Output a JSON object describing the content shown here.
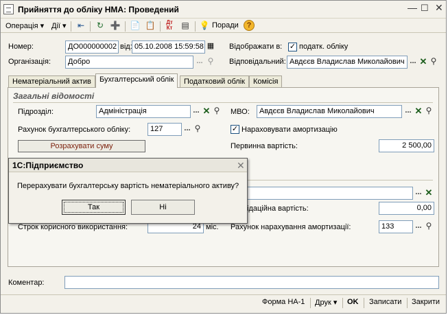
{
  "window": {
    "title": "Прийняття до обліку НМА: Проведений"
  },
  "toolbar": {
    "operation": "Операція",
    "actions": "Дії",
    "help": "Поради"
  },
  "header": {
    "number_label": "Номер:",
    "number": "ДО000000002",
    "date_label": "від:",
    "date": "05.10.2008 15:59:58",
    "display_label": "Відображати в:",
    "tax_accounting": "податк. обліку",
    "org_label": "Організація:",
    "org": "Добро",
    "responsible_label": "Відповідальний:",
    "responsible": "Авдєєв Владислав Миколайович"
  },
  "tabs": [
    {
      "label": "Нематеріальний актив"
    },
    {
      "label": "Бухгалтерський облік"
    },
    {
      "label": "Податковий облік"
    },
    {
      "label": "Комісія"
    }
  ],
  "accounting": {
    "group_title": "Загальні відомості",
    "division_label": "Підрозділ:",
    "division": "Адміністрація",
    "mvo_label": "МВО:",
    "mvo": "Авдєєв Владислав Миколайович",
    "account_label": "Рахунок бухгалтерського обліку:",
    "account": "127",
    "accrue_label": "Нараховувати амортизацію",
    "calc_button": "Розрахувати суму",
    "initial_cost_label": "Первинна вартість:",
    "initial_cost": "2 500,00",
    "liquidation_label": "ідаційна вартість:",
    "liquidation": "0,00",
    "useful_life_label": "Строк корисного використання:",
    "useful_life": "24",
    "useful_life_unit": "міс.",
    "amort_account_label": "Рахунок нарахування амортизації:",
    "amort_account": "133"
  },
  "comment_label": "Коментар:",
  "footer": {
    "form": "Форма НА-1",
    "print": "Друк",
    "ok": "OK",
    "save": "Записати",
    "close": "Закрити"
  },
  "dialog": {
    "title": "1С:Підприємство",
    "message": "Перерахувати бухгалтерську вартість нематеріального активу?",
    "yes": "Так",
    "no": "Ні"
  }
}
